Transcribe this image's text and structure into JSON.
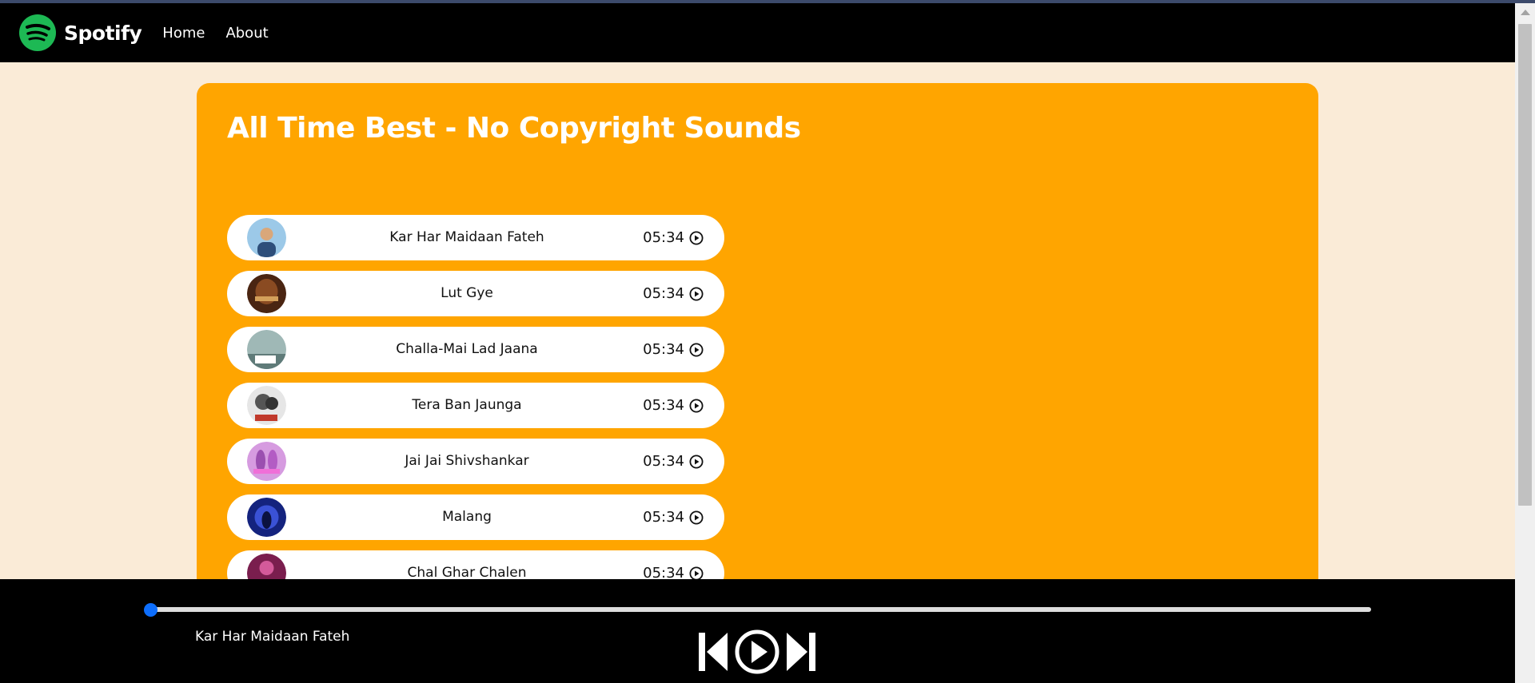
{
  "navbar": {
    "brand": "Spotify",
    "links": [
      "Home",
      "About"
    ],
    "logo_icon": "spotify-logo-icon",
    "logo_color": "#1db954"
  },
  "main": {
    "title": "All Time Best - No Copyright Sounds",
    "background_color": "#ffa500",
    "songs": [
      {
        "name": "Kar Har Maidaan Fateh",
        "duration": "05:34",
        "cover_color": "#7fb3d5"
      },
      {
        "name": "Lut Gye",
        "duration": "05:34",
        "cover_color": "#6e3b1e"
      },
      {
        "name": "Challa-Mai Lad Jaana",
        "duration": "05:34",
        "cover_color": "#8aa6a3"
      },
      {
        "name": "Tera Ban Jaunga",
        "duration": "05:34",
        "cover_color": "#b5b5b5"
      },
      {
        "name": "Jai Jai Shivshankar",
        "duration": "05:34",
        "cover_color": "#c77dd1"
      },
      {
        "name": "Malang",
        "duration": "05:34",
        "cover_color": "#1c2fa0"
      },
      {
        "name": "Chal Ghar Chalen",
        "duration": "05:34",
        "cover_color": "#a8326e"
      }
    ]
  },
  "player": {
    "now_playing": "Kar Har Maidaan Fateh",
    "progress": 0,
    "controls": [
      "previous-icon",
      "play-circle-icon",
      "next-icon"
    ],
    "accent": "#0d6efd"
  }
}
